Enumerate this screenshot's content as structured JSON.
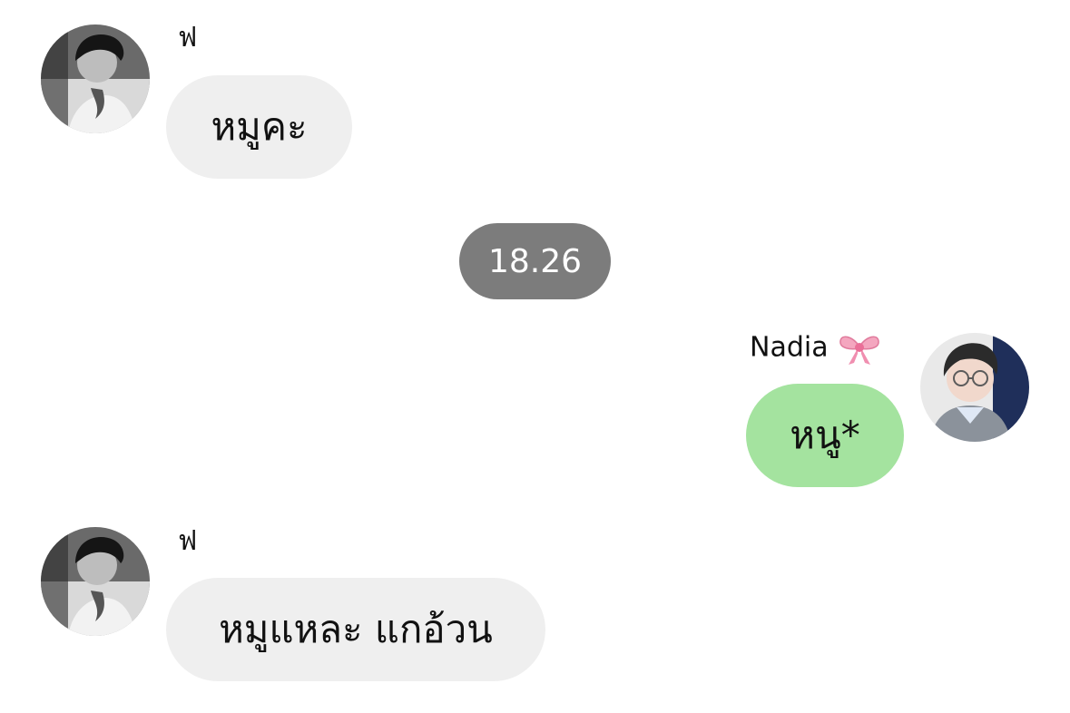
{
  "messages": [
    {
      "sender": "ฟ",
      "text": "หมูคะ",
      "direction": "incoming",
      "avatar": "incoming-avatar"
    },
    {
      "sender": "Nadia",
      "sender_icon": "ribbon-bow-icon",
      "text": "หนู*",
      "direction": "outgoing",
      "avatar": "outgoing-avatar"
    },
    {
      "sender": "ฟ",
      "text": "หมูแหละ แกอ้วน",
      "direction": "incoming",
      "avatar": "incoming-avatar"
    }
  ],
  "timestamp": "18.26",
  "colors": {
    "incoming_bubble": "#efefef",
    "outgoing_bubble": "#a4e39f",
    "timestamp_pill": "#7c7c7c",
    "timestamp_text": "#ffffff"
  }
}
